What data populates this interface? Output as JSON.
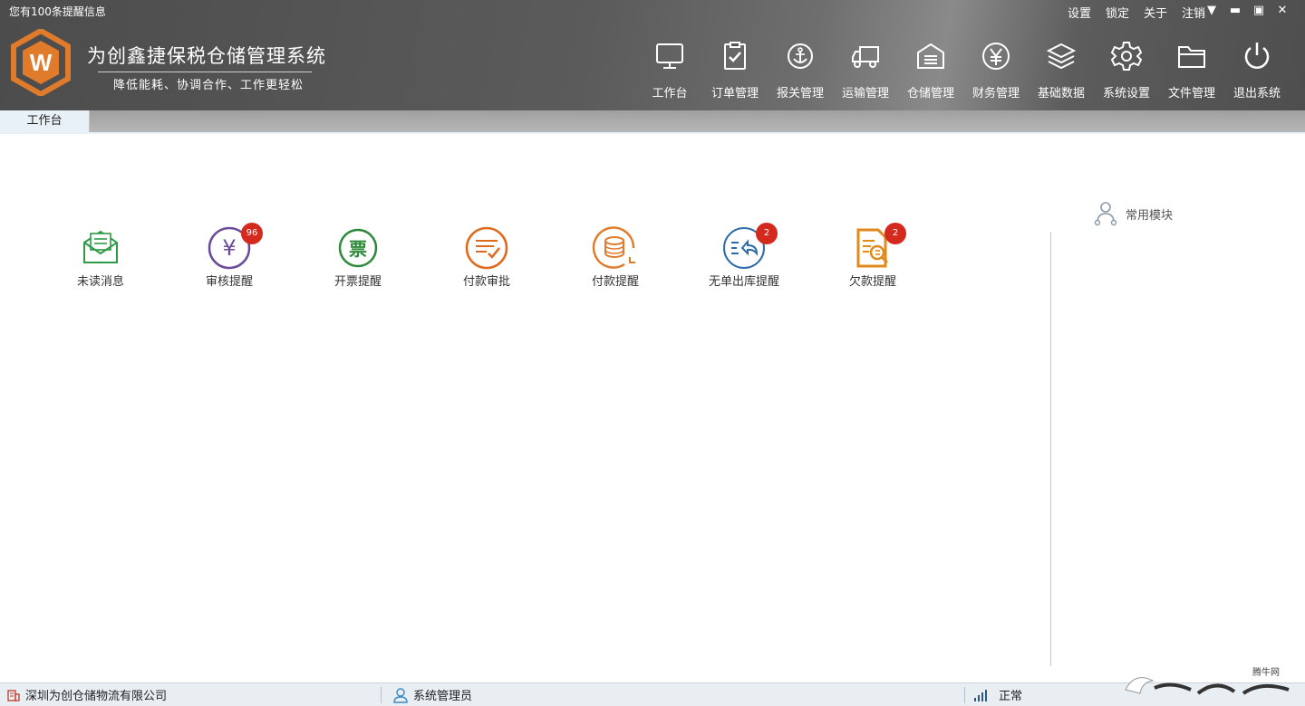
{
  "header": {
    "notice": "您有100条提醒信息",
    "links": [
      "设置",
      "锁定",
      "关于",
      "注销"
    ],
    "app_title": "为创鑫捷保税仓储管理系统",
    "app_subtitle": "降低能耗、协调合作、工作更轻松",
    "logo_letter": "W",
    "brand_color": "#e07b2c"
  },
  "nav": {
    "items": [
      {
        "label": "工作台",
        "icon": "monitor-icon"
      },
      {
        "label": "订单管理",
        "icon": "clipboard-check-icon"
      },
      {
        "label": "报关管理",
        "icon": "anchor-icon"
      },
      {
        "label": "运输管理",
        "icon": "truck-icon"
      },
      {
        "label": "仓储管理",
        "icon": "warehouse-icon"
      },
      {
        "label": "财务管理",
        "icon": "yen-icon"
      },
      {
        "label": "基础数据",
        "icon": "layers-icon"
      },
      {
        "label": "系统设置",
        "icon": "gear-icon"
      },
      {
        "label": "文件管理",
        "icon": "folder-icon"
      },
      {
        "label": "退出系统",
        "icon": "power-icon"
      }
    ]
  },
  "tabs": {
    "active": "工作台"
  },
  "modules": {
    "items": [
      {
        "label": "未读消息",
        "icon": "envelope-icon",
        "color": "#2e9a47",
        "badge": ""
      },
      {
        "label": "审核提醒",
        "icon": "yen-circle-icon",
        "color": "#6a4a9a",
        "badge": "96"
      },
      {
        "label": "开票提醒",
        "icon": "invoice-icon",
        "color": "#2e8a3a",
        "badge": ""
      },
      {
        "label": "付款审批",
        "icon": "approval-icon",
        "color": "#e06a1c",
        "badge": ""
      },
      {
        "label": "付款提醒",
        "icon": "coins-icon",
        "color": "#e07b2c",
        "badge": ""
      },
      {
        "label": "无单出库提醒",
        "icon": "return-icon",
        "color": "#2c6aa8",
        "badge": "2"
      },
      {
        "label": "欠款提醒",
        "icon": "document-search-icon",
        "color": "#e08a1c",
        "badge": "2"
      }
    ]
  },
  "right_panel": {
    "common_modules": "常用模块"
  },
  "status": {
    "company": "深圳为创仓储物流有限公司",
    "user": "系统管理员",
    "state": "正常"
  },
  "watermark": {
    "text": "腾牛网"
  }
}
